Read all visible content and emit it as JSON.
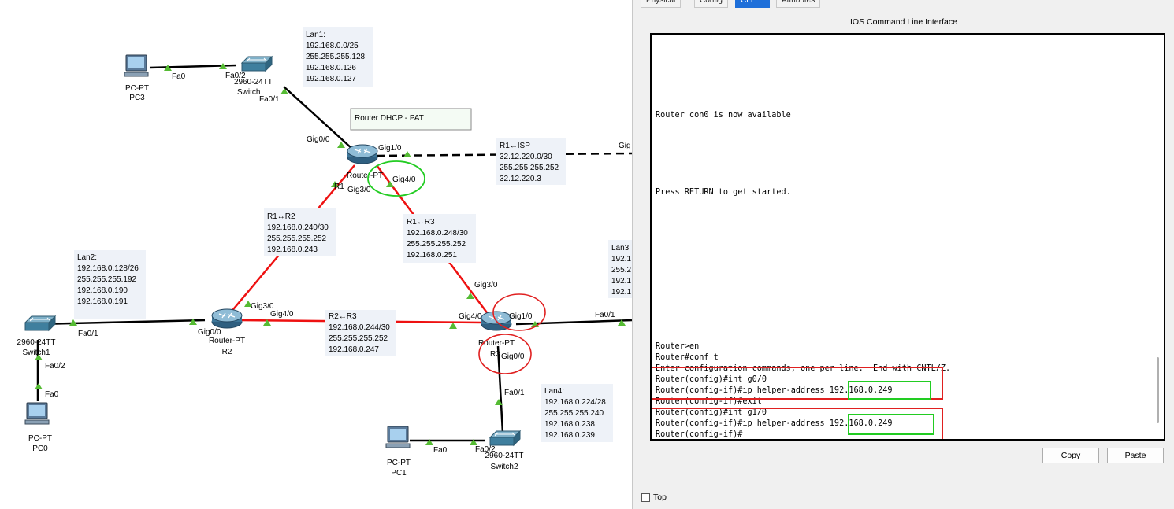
{
  "topology": {
    "note_label": "Router DHCP - PAT",
    "devices": {
      "pc3": {
        "type": "PC-PT",
        "name": "PC3"
      },
      "pc0": {
        "type": "PC-PT",
        "name": "PC0"
      },
      "pc1": {
        "type": "PC-PT",
        "name": "PC1"
      },
      "switch_top": {
        "model": "2960-24TT",
        "name": "Switch"
      },
      "switch1": {
        "model": "2960-24TT",
        "name": "Switch1"
      },
      "switch2": {
        "model": "2960-24TT",
        "name": "Switch2"
      },
      "r1": {
        "type": "Router-PT",
        "name": "R1"
      },
      "r2": {
        "type": "Router-PT",
        "name": "R2"
      },
      "r3": {
        "type": "Router-PT",
        "name": "R3"
      }
    },
    "ports": {
      "pc3_fa0": "Fa0",
      "sw_fa02": "Fa0/2",
      "sw_fa01": "Fa0/1",
      "r1_gig00": "Gig0/0",
      "r1_gig10": "Gig1/0",
      "r1_gig30": "Gig3/0",
      "r1_gig40": "Gig4/0",
      "r2_gig30": "Gig3/0",
      "r2_gig40": "Gig4/0",
      "r2_gig00": "Gig0/0",
      "sw1_fa01": "Fa0/1",
      "sw1_fa02": "Fa0/2",
      "pc0_fa0": "Fa0",
      "r3_gig30": "Gig3/0",
      "r3_gig40": "Gig4/0",
      "r3_gig10": "Gig1/0",
      "r3_gig00": "Gig0/0",
      "r3_fa01": "Fa0/1",
      "isp_gig": "Gig",
      "sw2_fa01": "Fa0/1",
      "sw2_fa02": "Fa0/2",
      "pc1_fa0": "Fa0"
    },
    "notes": {
      "lan1": [
        "Lan1:",
        "192.168.0.0/25",
        "255.255.255.128",
        "192.168.0.126",
        "192.168.0.127"
      ],
      "r1_isp": [
        "R1↔ISP",
        "32.12.220.0/30",
        "255.255.255.252",
        "32.12.220.3"
      ],
      "r1_r2": [
        "R1↔R2",
        "192.168.0.240/30",
        "255.255.255.252",
        "192.168.0.243"
      ],
      "r1_r3": [
        "R1↔R3",
        "192.168.0.248/30",
        "255.255.255.252",
        "192.168.0.251"
      ],
      "lan2": [
        "Lan2:",
        "192.168.0.128/26",
        "255.255.255.192",
        "192.168.0.190",
        "192.168.0.191"
      ],
      "r2_r3": [
        "R2↔R3",
        "192.168.0.244/30",
        "255.255.255.252",
        "192.168.0.247"
      ],
      "lan3": [
        "Lan3",
        "192.1",
        "255.2",
        "192.1",
        "192.1"
      ],
      "lan4": [
        "Lan4:",
        "192.168.0.224/28",
        "255.255.255.240",
        "192.168.0.238",
        "192.168.0.239"
      ]
    }
  },
  "cli": {
    "tabs": [
      "Physical",
      "Config",
      "CLI",
      "Attributes"
    ],
    "active_tab": "CLI",
    "heading": "IOS Command Line Interface",
    "lines": [
      "Router con0 is now available",
      "Press RETURN to get started.",
      "Router>en",
      "Router#conf t",
      "Enter configuration commands, one per line.  End with CNTL/Z.",
      "Router(config)#int g0/0",
      "Router(config-if)#ip helper-address 192.168.0.249",
      "Router(config-if)#exit",
      "Router(config)#int g1/0",
      "Router(config-if)#ip helper-address 192.168.0.249",
      "Router(config-if)#"
    ],
    "copy_label": "Copy",
    "paste_label": "Paste",
    "top_label": "Top"
  },
  "colors": {
    "ethernet_link": "#000000",
    "router_link": "#ee1111",
    "port_up": "#55bb33",
    "highlight_red": "#e02020",
    "highlight_green": "#22cc22",
    "active_tab": "#1e6fd9"
  }
}
